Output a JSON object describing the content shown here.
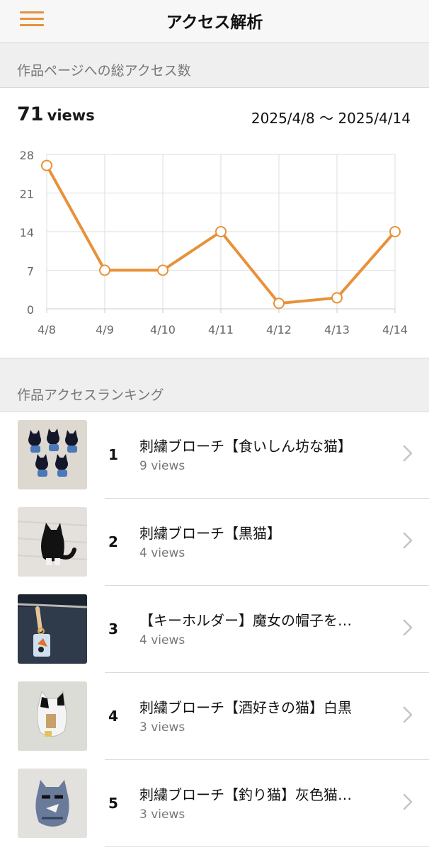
{
  "header": {
    "title": "アクセス解析",
    "menu_icon": "hamburger-menu-icon",
    "accent": "#e8913a"
  },
  "summary": {
    "section_label": "作品ページへの総アクセス数",
    "total": "71",
    "unit": "views",
    "date_range": "2025/4/8 〜 2025/4/14"
  },
  "chart_data": {
    "type": "line",
    "categories": [
      "4/8",
      "4/9",
      "4/10",
      "4/11",
      "4/12",
      "4/13",
      "4/14"
    ],
    "values": [
      26,
      7,
      7,
      14,
      1,
      2,
      14
    ],
    "yticks": [
      0,
      7,
      14,
      21,
      28
    ],
    "ylim": [
      0,
      28
    ],
    "grid": true,
    "color": "#e8913a"
  },
  "ranking": {
    "section_label": "作品アクセスランキング",
    "items": [
      {
        "rank": "1",
        "title": "刺繍ブローチ【食いしん坊な猫】",
        "views": "9 views"
      },
      {
        "rank": "2",
        "title": "刺繍ブローチ【黒猫】",
        "views": "4 views"
      },
      {
        "rank": "3",
        "title": "【キーホルダー】魔女の帽子を…",
        "views": "4 views"
      },
      {
        "rank": "4",
        "title": "刺繍ブローチ【酒好きの猫】白黒",
        "views": "3 views"
      },
      {
        "rank": "5",
        "title": "刺繍ブローチ【釣り猫】灰色猫…",
        "views": "3 views"
      }
    ]
  }
}
